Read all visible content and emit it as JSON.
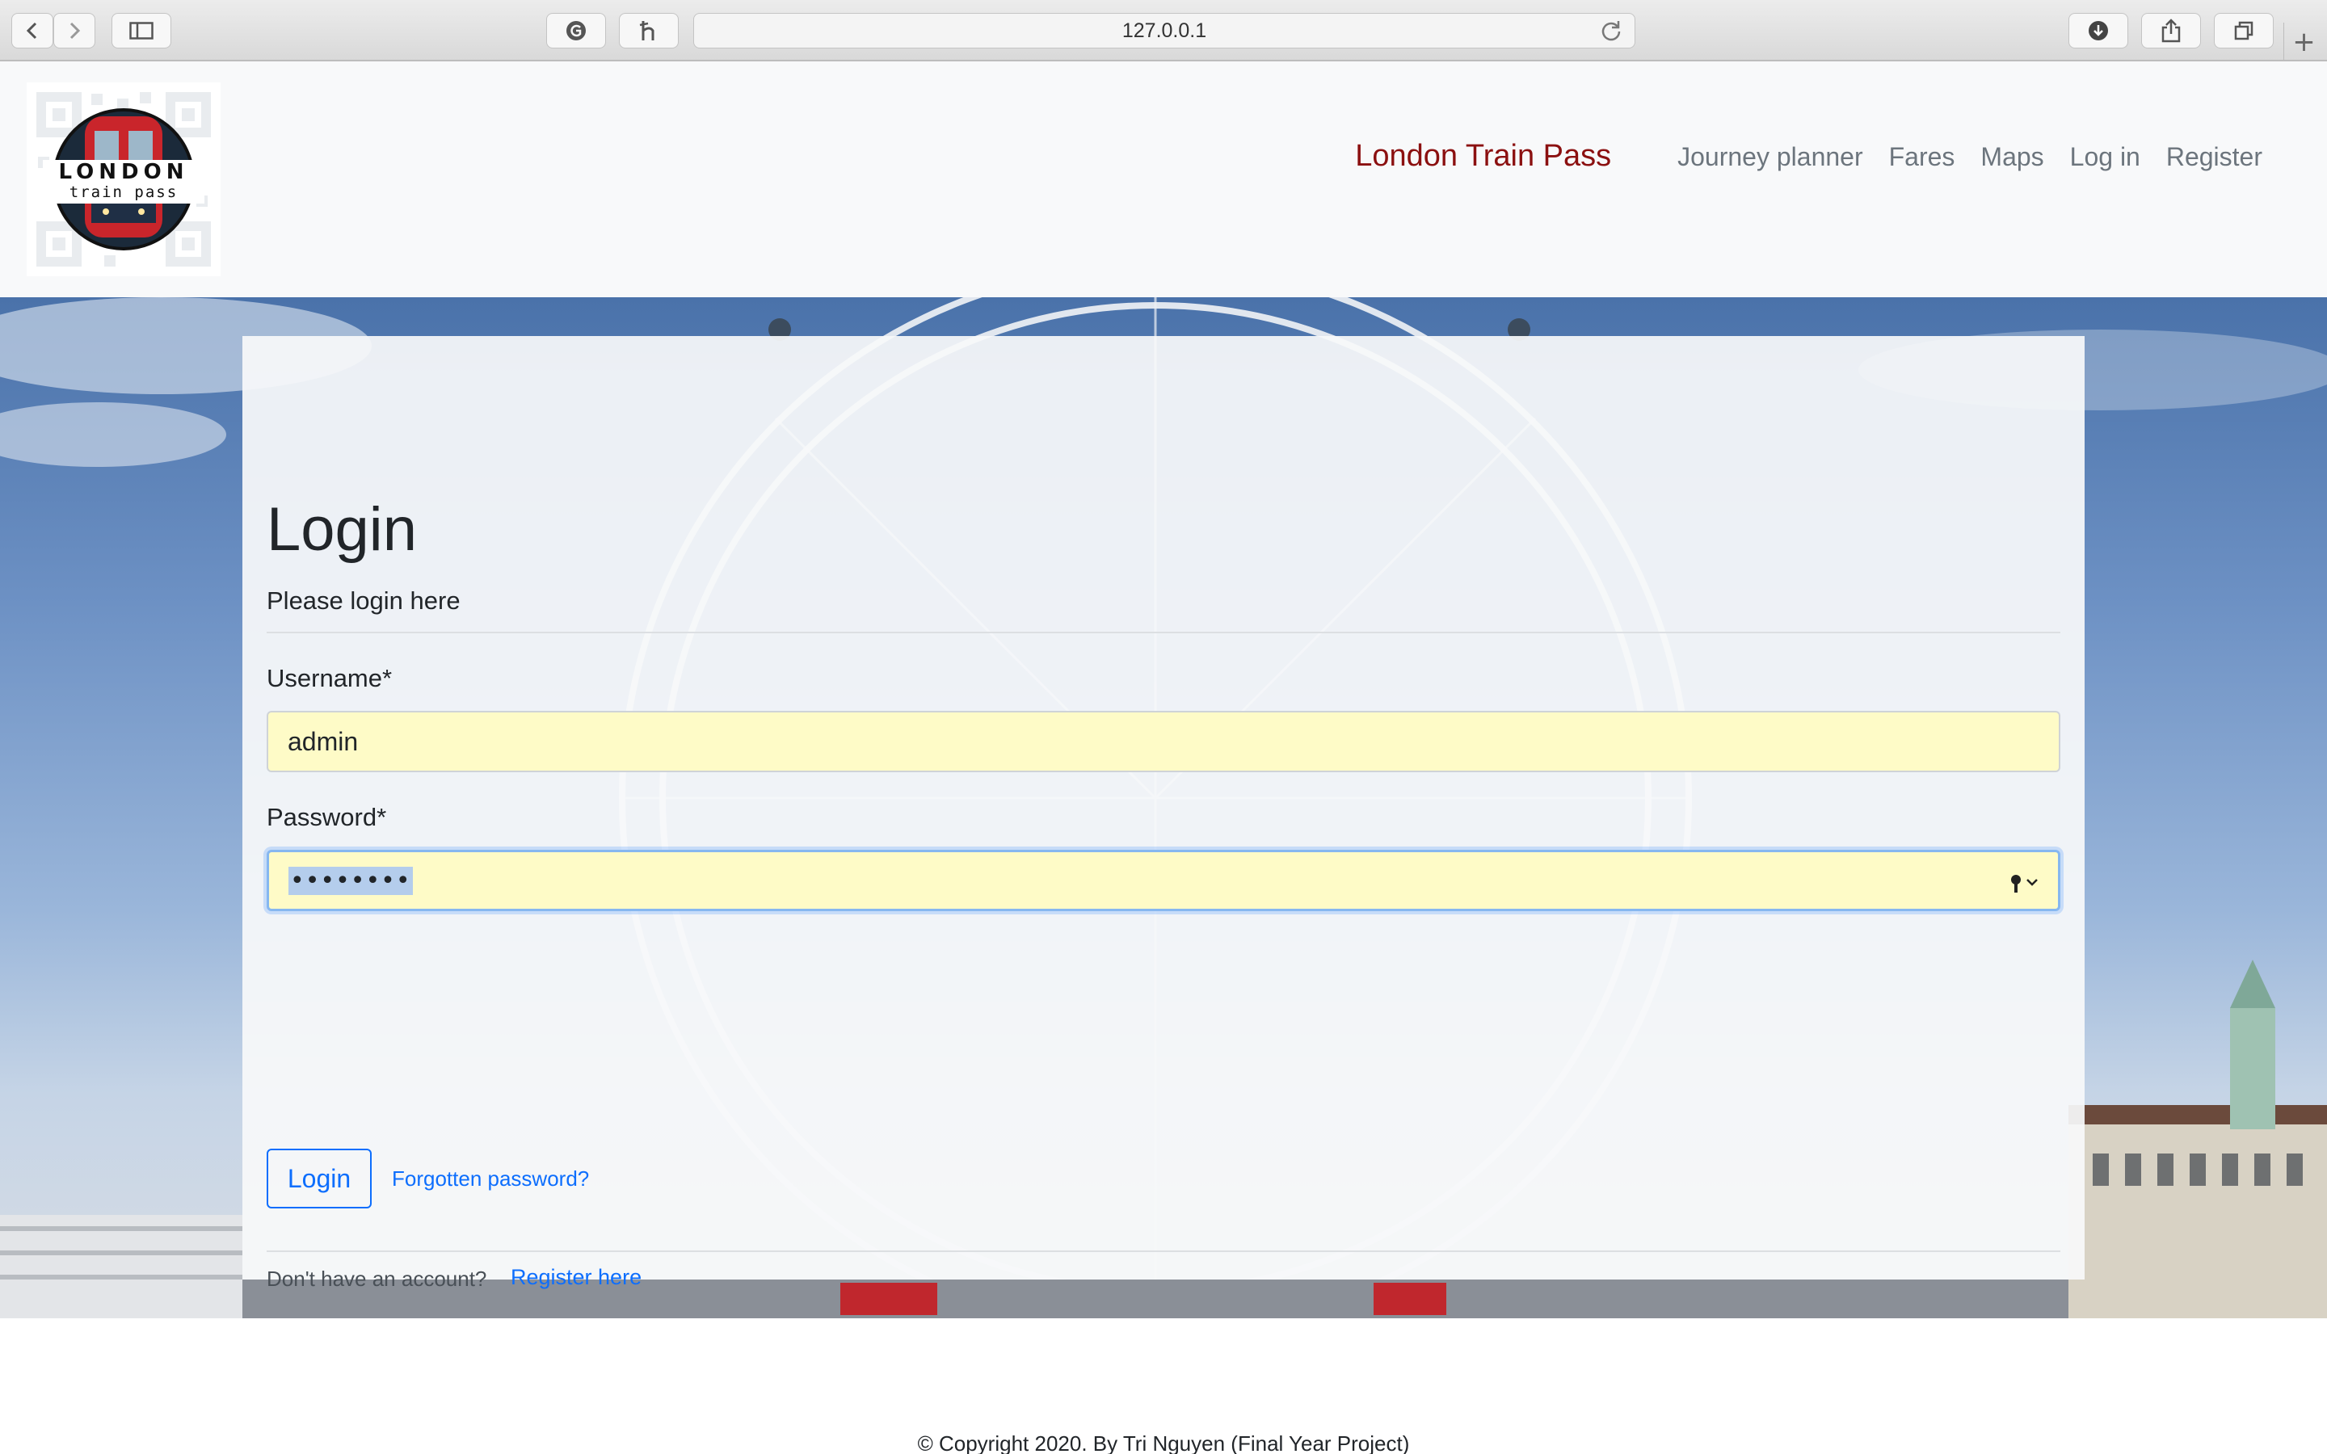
{
  "browser": {
    "url": "127.0.0.1",
    "icons": [
      "back-icon",
      "forward-icon",
      "sidebar-icon",
      "grammarly-icon",
      "honey-icon",
      "reload-icon",
      "download-icon",
      "share-icon",
      "tabs-icon",
      "new-tab-icon"
    ]
  },
  "header": {
    "logo_top": "LONDON",
    "logo_bottom": "train pass",
    "brand": "London Train Pass",
    "nav": [
      "Journey planner",
      "Fares",
      "Maps",
      "Log in",
      "Register"
    ]
  },
  "login": {
    "title": "Login",
    "subtitle": "Please login here",
    "username_label": "Username*",
    "username_value": "admin",
    "password_label": "Password*",
    "password_value": "••••••••",
    "submit": "Login",
    "forgot": "Forgotten password?",
    "no_account": "Don't have an account?",
    "register_link": "Register here"
  },
  "footer": {
    "copyright": "© Copyright 2020. By Tri Nguyen (Final Year Project)"
  },
  "colors": {
    "brand": "#8b1010",
    "link": "#0d6efd",
    "autofill": "#fefbc7"
  }
}
